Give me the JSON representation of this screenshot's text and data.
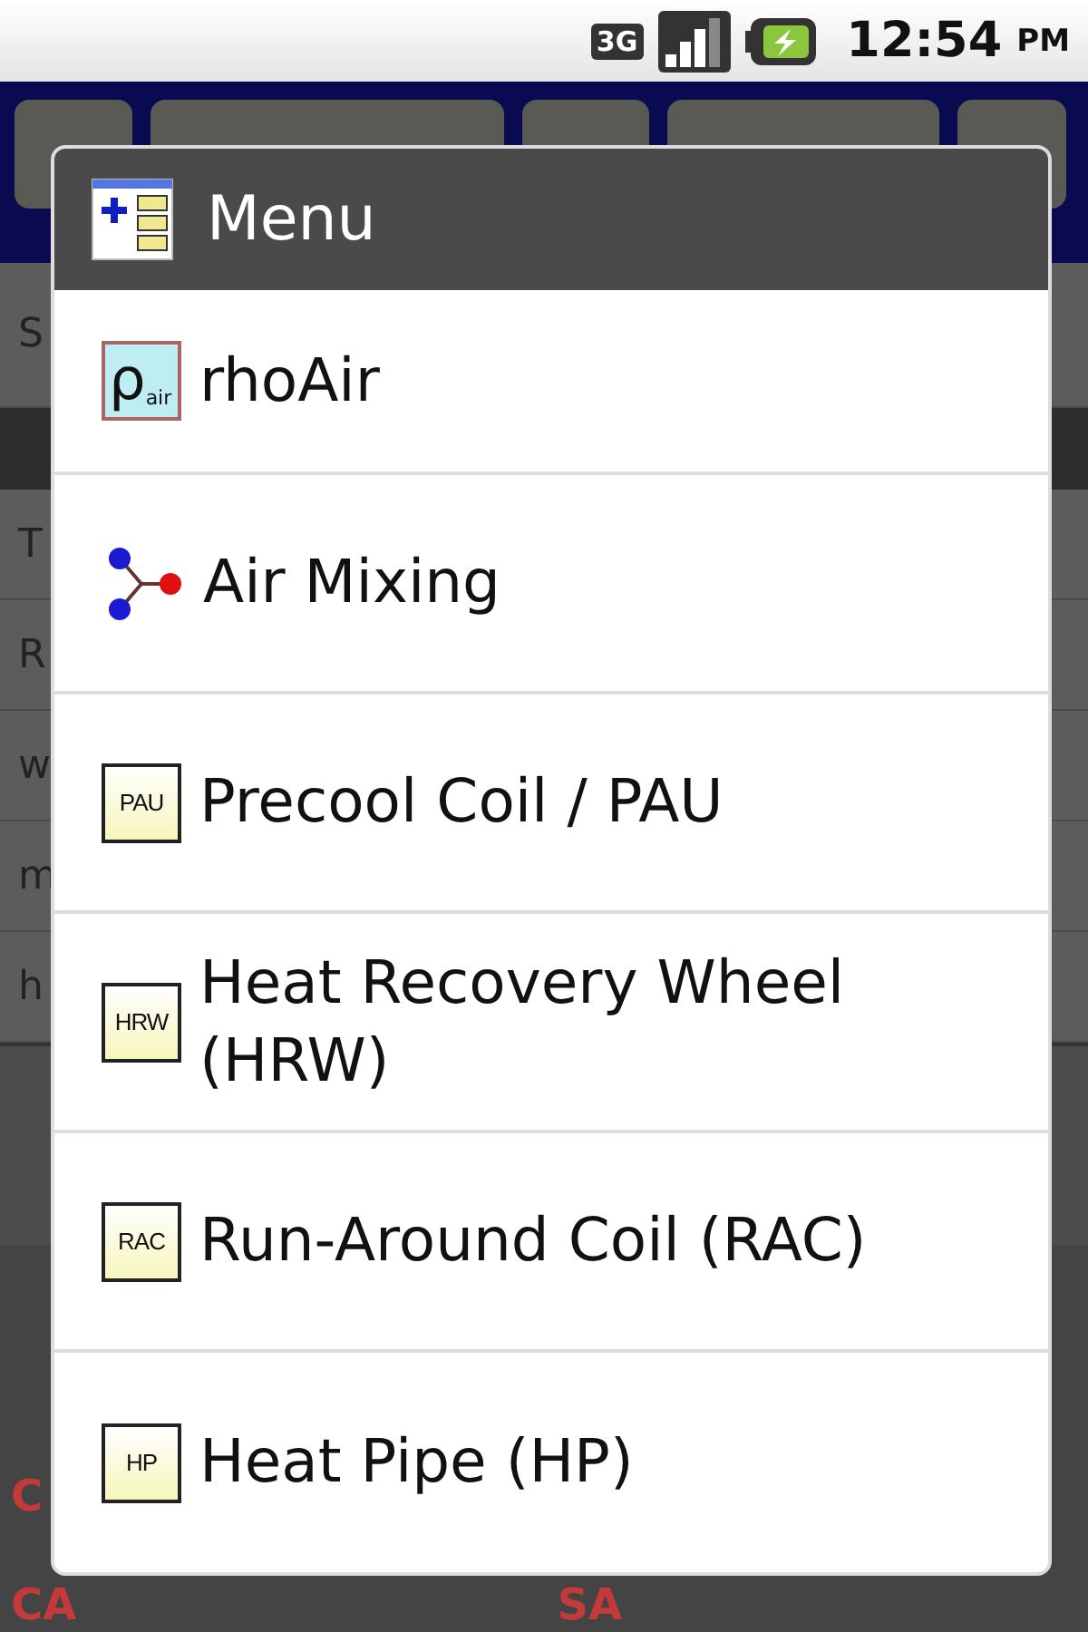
{
  "status_bar": {
    "network": "3G",
    "time": "12:54",
    "ampm": "PM"
  },
  "background": {
    "top_label": "S",
    "row_labels": [
      "T",
      "R",
      "w",
      "m",
      "h"
    ],
    "bottom_left": "C",
    "bottom_labels": [
      "CA",
      "SA"
    ]
  },
  "menu": {
    "title": "Menu",
    "items": [
      {
        "kind": "rho",
        "label": "rhoAir",
        "icon_text": "ρ",
        "icon_sub": "air"
      },
      {
        "kind": "mixing",
        "label": "Air Mixing"
      },
      {
        "kind": "tag",
        "label": "Precool Coil / PAU",
        "icon_text": "PAU"
      },
      {
        "kind": "tag",
        "label": "Heat Recovery Wheel (HRW)",
        "icon_text": "HRW"
      },
      {
        "kind": "tag",
        "label": "Run-Around Coil (RAC)",
        "icon_text": "RAC"
      },
      {
        "kind": "tag",
        "label": "Heat Pipe (HP)",
        "icon_text": "HP"
      }
    ]
  }
}
